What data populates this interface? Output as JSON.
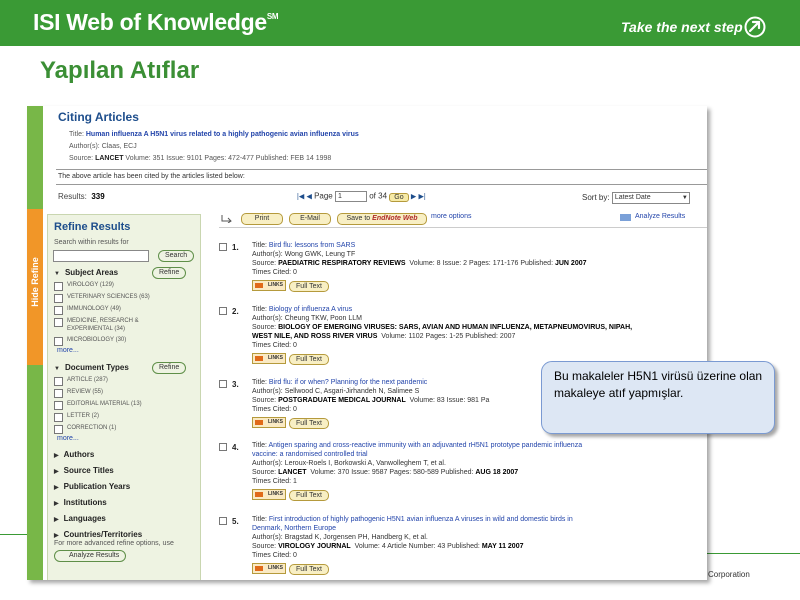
{
  "header": {
    "brand": "ISI Web of Knowledge",
    "trademark": "SM",
    "tagline": "Take the next step"
  },
  "slide_title": "Yapılan Atıflar",
  "footer": {
    "corporation": "Corporation"
  },
  "citing": {
    "heading": "Citing Articles",
    "title_label": "Title:",
    "title_value": "Human influenza A H5N1 virus related to a highly pathogenic avian influenza virus",
    "authors_label": "Author(s):",
    "authors_value": "Claas, ECJ",
    "source_label": "Source:",
    "source_journal": "LANCET",
    "source_rest": "Volume: 351  Issue: 9101  Pages: 472-477  Published: FEB 14 1998",
    "note": "The above article has been cited by the articles listed below:"
  },
  "results_bar": {
    "label": "Results:",
    "count": "339",
    "page_label": "Page",
    "page_value": "1",
    "of_label": "of",
    "total_pages": "34",
    "go_label": "Go",
    "sort_label": "Sort by:",
    "sort_value": "Latest Date"
  },
  "hide_refine": "Hide Refine",
  "refine": {
    "title": "Refine Results",
    "search_label": "Search within results for",
    "search_button": "Search",
    "subject_areas": {
      "label": "Subject Areas",
      "button": "Refine",
      "items": [
        "VIROLOGY (129)",
        "VETERINARY SCIENCES (63)",
        "IMMUNOLOGY (49)",
        "MEDICINE, RESEARCH &",
        "EXPERIMENTAL (34)",
        "MICROBIOLOGY (30)"
      ],
      "more": "more..."
    },
    "doc_types": {
      "label": "Document Types",
      "button": "Refine",
      "items": [
        "ARTICLE (287)",
        "REVIEW (55)",
        "EDITORIAL MATERIAL (13)",
        "LETTER (2)",
        "CORRECTION (1)"
      ],
      "more": "more..."
    },
    "collapsed": [
      "Authors",
      "Source Titles",
      "Publication Years",
      "Institutions",
      "Languages",
      "Countries/Territories"
    ],
    "advanced_note": "For more advanced refine options, use",
    "analyze_button": "Analyze Results"
  },
  "toolbar": {
    "print": "Print",
    "email": "E-Mail",
    "save_to": "Save to",
    "endnote": "EndNote Web",
    "more_options": "more options",
    "analyze": "Analyze Results"
  },
  "labels": {
    "title": "Title:",
    "authors": "Author(s):",
    "source": "Source:",
    "times_cited": "Times Cited:",
    "links": "LINKS",
    "full_text": "Full Text"
  },
  "articles": [
    {
      "num": "1.",
      "title": "Bird flu: lessons from SARS",
      "authors": "Wong GWK, Leung TF",
      "journal": "PAEDIATRIC RESPIRATORY REVIEWS",
      "details": "Volume: 8   Issue: 2   Pages: 171-176   Published:",
      "published": "JUN 2007",
      "times_cited": "0"
    },
    {
      "num": "2.",
      "title": "Biology of influenza A virus",
      "authors": "Cheung TKW, Poon LLM",
      "journal": "BIOLOGY OF EMERGING VIRUSES: SARS, AVIAN AND HUMAN INFLUENZA, METAPNEUMOVIRUS, NIPAH,",
      "journal2": "WEST NILE, AND ROSS RIVER VIRUS",
      "details": "Volume: 1102   Pages: 1-25   Published: 2007",
      "times_cited": "0"
    },
    {
      "num": "3.",
      "title": "Bird flu: if or when? Planning for the next pandemic",
      "authors": "Sellwood C, Asgari-Jirhandeh N, Salimee S",
      "journal": "POSTGRADUATE MEDICAL JOURNAL",
      "details": "Volume: 83   Issue: 981   Pa",
      "times_cited": "0"
    },
    {
      "num": "4.",
      "title": "Antigen sparing and cross-reactive immunity with an adjuvanted rH5N1 prototype pandemic influenza",
      "title2": "vaccine: a randomised controlled trial",
      "authors": "Leroux-Roels I, Borkowski A, Vanwolleghem T, et al.",
      "journal": "LANCET",
      "details": "Volume: 370   Issue: 9587   Pages: 580-589   Published:",
      "published": "AUG 18 2007",
      "times_cited": "1"
    },
    {
      "num": "5.",
      "title": "First introduction of highly pathogenic H5N1 avian influenza A viruses in wild and domestic birds in",
      "title2": "Denmark, Northern Europe",
      "authors": "Bragstad K, Jorgensen PH, Handberg K, et al.",
      "journal": "VIROLOGY JOURNAL",
      "details": "Volume: 4  Article Number: 43   Published:",
      "published": "MAY 11 2007",
      "times_cited": "0"
    }
  ],
  "callout": "Bu makaleler H5N1 virüsü üzerine olan makaleye atıf yapmışlar.",
  "colors": {
    "header_green": "#3a9a35",
    "title_green": "#3b8f35",
    "refine_bg": "#eef3e2",
    "tab_orange": "#f19628",
    "callout_bg": "#dde7f4",
    "link_blue": "#2244aa"
  }
}
